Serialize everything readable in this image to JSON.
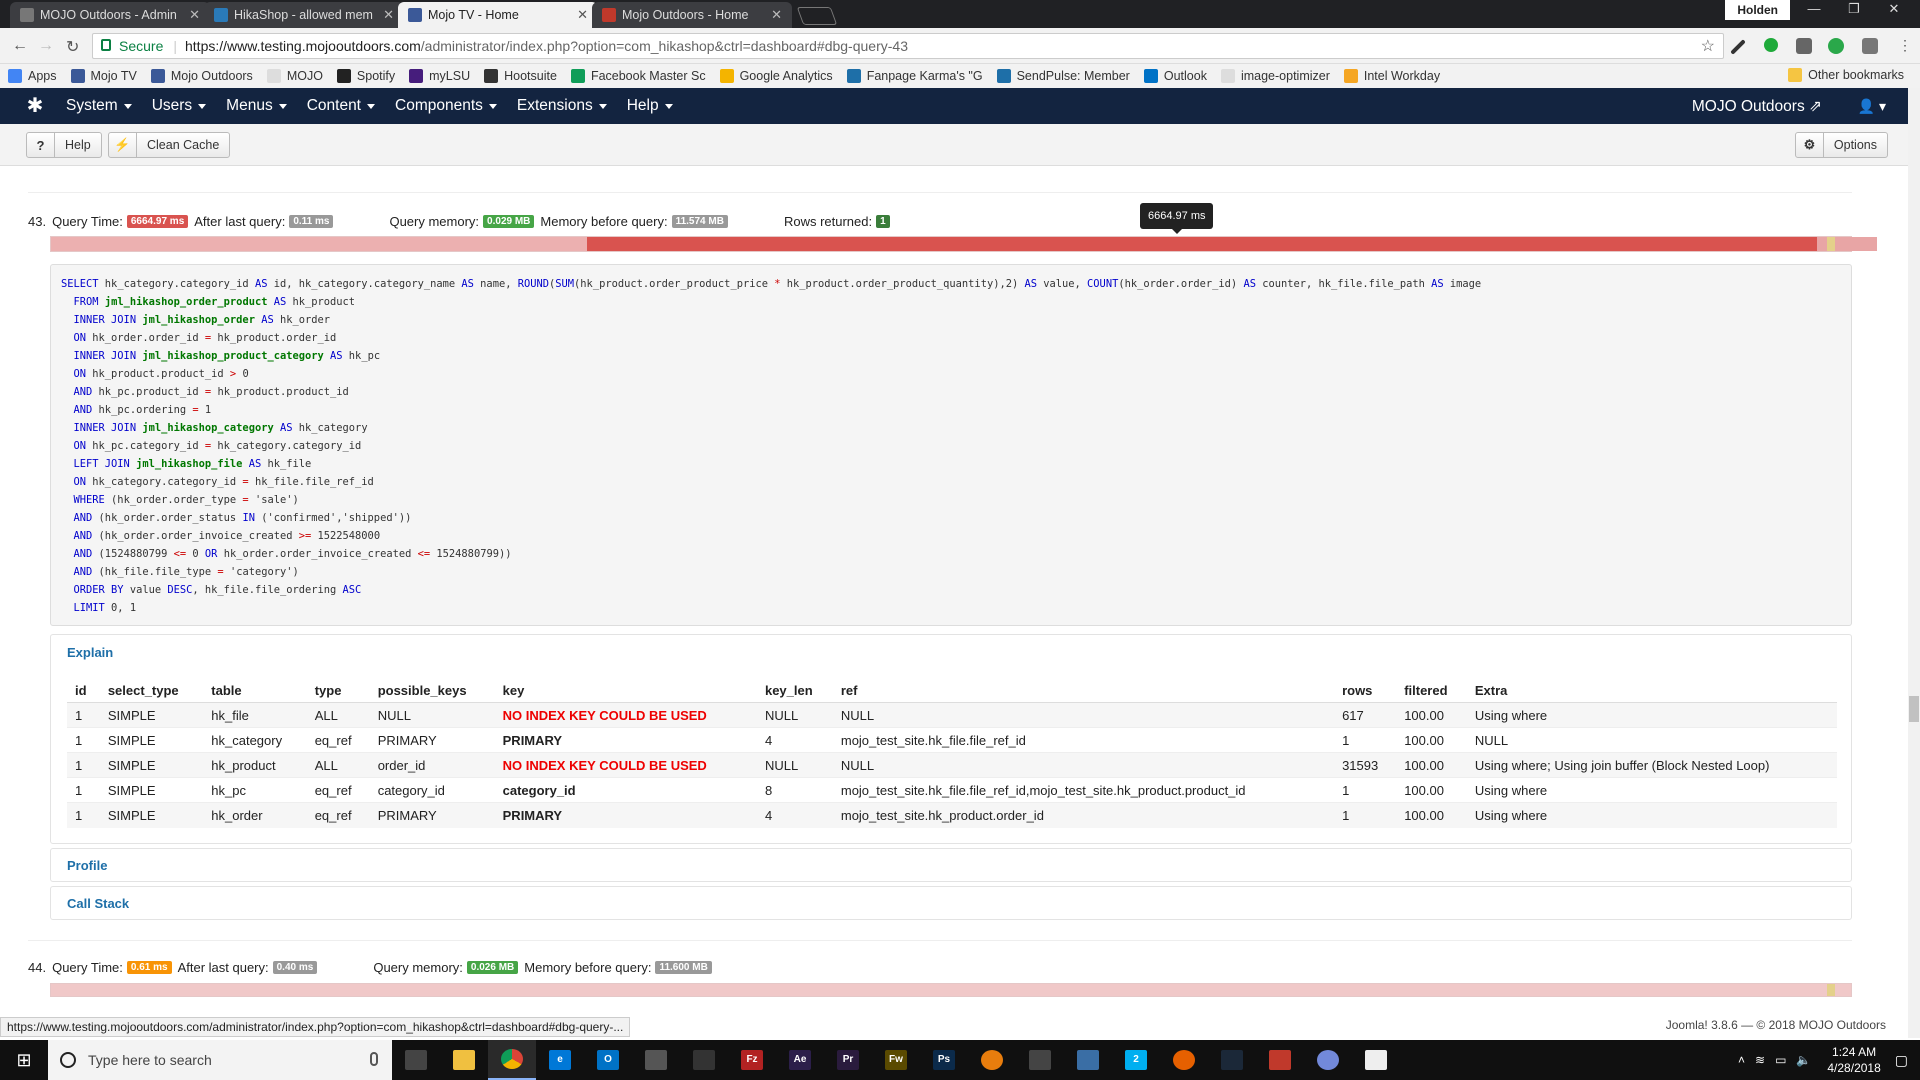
{
  "browser": {
    "tabs": [
      {
        "title": "MOJO Outdoors - Admin",
        "favicon": "page-icon",
        "color": "#777"
      },
      {
        "title": "HikaShop - allowed mem",
        "favicon": "hikashop-icon",
        "color": "#2a7ab8"
      },
      {
        "title": "Mojo TV - Home",
        "favicon": "facebook-icon",
        "color": "#3b5998"
      },
      {
        "title": "Mojo Outdoors - Home",
        "favicon": "mojo-icon",
        "color": "#c0392b"
      }
    ],
    "active_tab": 2,
    "user_label": "Holden",
    "secure_label": "Secure",
    "url_host": "https://www.testing.mojooutdoors.com",
    "url_rest": "/administrator/index.php?option=com_hikashop&ctrl=dashboard#dbg-query-43",
    "bookmarks": [
      {
        "label": "Apps",
        "icon": "apps-grid-icon",
        "color": "#4285f4"
      },
      {
        "label": "Mojo TV",
        "icon": "facebook-icon",
        "color": "#3b5998"
      },
      {
        "label": "Mojo Outdoors",
        "icon": "facebook-icon",
        "color": "#3b5998"
      },
      {
        "label": "MOJO",
        "icon": "page-icon",
        "color": "#ddd"
      },
      {
        "label": "Spotify",
        "icon": "spotify-icon",
        "color": "#222"
      },
      {
        "label": "myLSU",
        "icon": "lsu-icon",
        "color": "#461d7c"
      },
      {
        "label": "Hootsuite",
        "icon": "hootsuite-icon",
        "color": "#333"
      },
      {
        "label": "Facebook Master Sc",
        "icon": "sheets-icon",
        "color": "#0f9d58"
      },
      {
        "label": "Google Analytics",
        "icon": "analytics-icon",
        "color": "#f4b400"
      },
      {
        "label": "Fanpage Karma's \"G",
        "icon": "fk-icon",
        "color": "#1e6fa8"
      },
      {
        "label": "SendPulse: Member",
        "icon": "sendpulse-icon",
        "color": "#1e6fa8"
      },
      {
        "label": "Outlook",
        "icon": "outlook-icon",
        "color": "#0072c6"
      },
      {
        "label": "image-optimizer",
        "icon": "page-icon",
        "color": "#ddd"
      },
      {
        "label": "Intel Workday",
        "icon": "workday-icon",
        "color": "#f5a623"
      }
    ],
    "other_bookmarks": "Other bookmarks"
  },
  "joomla": {
    "menu": [
      "System",
      "Users",
      "Menus",
      "Content",
      "Components",
      "Extensions",
      "Help"
    ],
    "site_name": "MOJO Outdoors",
    "toolbar": {
      "help": "Help",
      "clean_cache": "Clean Cache",
      "options": "Options"
    }
  },
  "query43": {
    "number": "43.",
    "query_time_label": "Query Time:",
    "query_time": "6664.97 ms",
    "after_last_label": "After last query:",
    "after_last": "0.11 ms",
    "memory_label": "Query memory:",
    "memory": "0.029 MB",
    "mem_before_label": "Memory before query:",
    "mem_before": "11.574 MB",
    "rows_label": "Rows returned:",
    "rows": "1",
    "tooltip": "6664.97 ms",
    "sql": [
      "SELECT hk_category.category_id AS id, hk_category.category_name AS name, ROUND(SUM(hk_product.order_product_price * hk_product.order_product_quantity),2) AS value, COUNT(hk_order.order_id) AS counter, hk_file.file_path AS image",
      "  FROM jml_hikashop_order_product AS hk_product",
      "  INNER JOIN jml_hikashop_order AS hk_order",
      "  ON hk_order.order_id = hk_product.order_id",
      "  INNER JOIN jml_hikashop_product_category AS hk_pc",
      "  ON hk_product.product_id > 0",
      "  AND hk_pc.product_id = hk_product.product_id",
      "  AND hk_pc.ordering = 1",
      "  INNER JOIN jml_hikashop_category AS hk_category",
      "  ON hk_pc.category_id = hk_category.category_id",
      "  LEFT JOIN jml_hikashop_file AS hk_file",
      "  ON hk_category.category_id = hk_file.file_ref_id",
      "  WHERE (hk_order.order_type = 'sale')",
      "  AND (hk_order.order_status IN ('confirmed','shipped'))",
      "  AND (hk_order.order_invoice_created >= 1522548000",
      "  AND (1524880799 <= 0 OR hk_order.order_invoice_created <= 1524880799))",
      "  AND (hk_file.file_type = 'category')",
      "  ORDER BY value DESC, hk_file.file_ordering ASC",
      "  LIMIT 0, 1"
    ],
    "explain_title": "Explain",
    "profile_title": "Profile",
    "callstack_title": "Call Stack",
    "explain": {
      "headers": [
        "id",
        "select_type",
        "table",
        "type",
        "possible_keys",
        "key",
        "key_len",
        "ref",
        "rows",
        "filtered",
        "Extra"
      ],
      "rows": [
        [
          "1",
          "SIMPLE",
          "hk_file",
          "ALL",
          "NULL",
          "NO INDEX KEY COULD BE USED",
          "NULL",
          "NULL",
          "617",
          "100.00",
          "Using where"
        ],
        [
          "1",
          "SIMPLE",
          "hk_category",
          "eq_ref",
          "PRIMARY",
          "PRIMARY",
          "4",
          "mojo_test_site.hk_file.file_ref_id",
          "1",
          "100.00",
          "NULL"
        ],
        [
          "1",
          "SIMPLE",
          "hk_product",
          "ALL",
          "order_id",
          "NO INDEX KEY COULD BE USED",
          "NULL",
          "NULL",
          "31593",
          "100.00",
          "Using where; Using join buffer (Block Nested Loop)"
        ],
        [
          "1",
          "SIMPLE",
          "hk_pc",
          "eq_ref",
          "category_id",
          "category_id",
          "8",
          "mojo_test_site.hk_file.file_ref_id,mojo_test_site.hk_product.product_id",
          "1",
          "100.00",
          "Using where"
        ],
        [
          "1",
          "SIMPLE",
          "hk_order",
          "eq_ref",
          "PRIMARY",
          "PRIMARY",
          "4",
          "mojo_test_site.hk_product.order_id",
          "1",
          "100.00",
          "Using where"
        ]
      ]
    }
  },
  "query44": {
    "number": "44.",
    "query_time_label": "Query Time:",
    "query_time": "0.61 ms",
    "after_last_label": "After last query:",
    "after_last": "0.40 ms",
    "memory_label": "Query memory:",
    "memory": "0.026 MB",
    "mem_before_label": "Memory before query:",
    "mem_before": "11.600 MB"
  },
  "status_url": "https://www.testing.mojooutdoors.com/administrator/index.php?option=com_hikashop&ctrl=dashboard#dbg-query-...",
  "footer": "Joomla! 3.8.6 — © 2018 MOJO Outdoors",
  "taskbar": {
    "search_placeholder": "Type here to search",
    "time": "1:24 AM",
    "date": "4/28/2018",
    "apps": [
      {
        "name": "task-view-icon",
        "color": "#444",
        "label": ""
      },
      {
        "name": "file-explorer-icon",
        "color": "#f0c040",
        "label": ""
      },
      {
        "name": "chrome-icon",
        "color": "#db4437",
        "label": ""
      },
      {
        "name": "edge-icon",
        "color": "#0078d7",
        "label": "e"
      },
      {
        "name": "outlook-icon",
        "color": "#0072c6",
        "label": "O"
      },
      {
        "name": "app-icon",
        "color": "#555",
        "label": ""
      },
      {
        "name": "obs-icon",
        "color": "#333",
        "label": ""
      },
      {
        "name": "filezilla-icon",
        "color": "#b22222",
        "label": "Fz"
      },
      {
        "name": "after-effects-icon",
        "color": "#2c1f4a",
        "label": "Ae"
      },
      {
        "name": "premiere-icon",
        "color": "#2a1b3d",
        "label": "Pr"
      },
      {
        "name": "fireworks-icon",
        "color": "#5a4a00",
        "label": "Fw"
      },
      {
        "name": "photoshop-icon",
        "color": "#0b2a4a",
        "label": "Ps"
      },
      {
        "name": "blender-icon",
        "color": "#e87d0d",
        "label": ""
      },
      {
        "name": "unity-icon",
        "color": "#444",
        "label": ""
      },
      {
        "name": "network-icon",
        "color": "#3a6ea5",
        "label": ""
      },
      {
        "name": "skype-icon",
        "color": "#00aff0",
        "label": "2"
      },
      {
        "name": "firefox-icon",
        "color": "#e66000",
        "label": ""
      },
      {
        "name": "steam-icon",
        "color": "#1b2838",
        "label": ""
      },
      {
        "name": "game-icon",
        "color": "#c0392b",
        "label": ""
      },
      {
        "name": "discord-icon",
        "color": "#7289da",
        "label": ""
      },
      {
        "name": "notes-icon",
        "color": "#eee",
        "label": ""
      }
    ]
  }
}
